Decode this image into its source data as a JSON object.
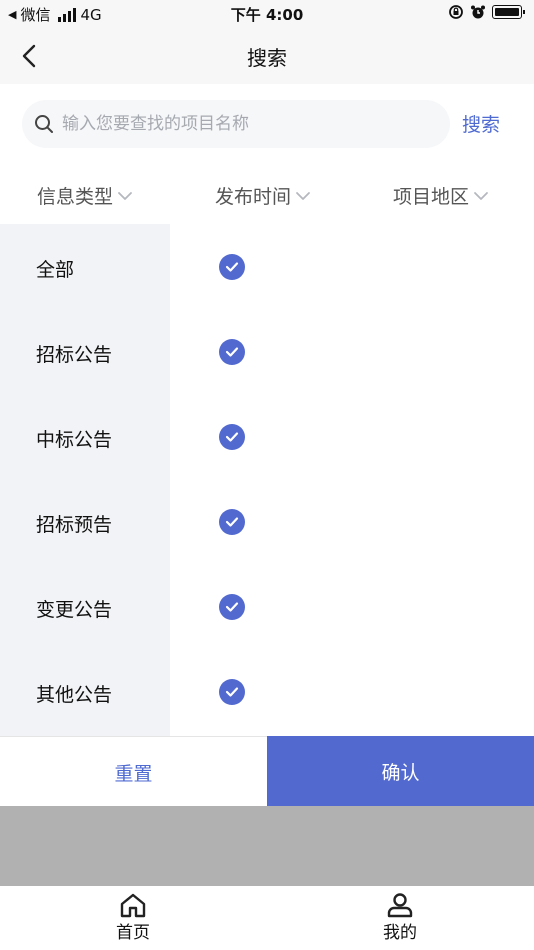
{
  "status_bar": {
    "carrier": "微信",
    "network": "4G",
    "time": "下午 4:00"
  },
  "nav": {
    "title": "搜索",
    "back_icon": "chevron-left-icon"
  },
  "search": {
    "placeholder": "输入您要查找的项目名称",
    "value": "",
    "button_label": "搜索"
  },
  "filters": [
    {
      "label": "信息类型"
    },
    {
      "label": "发布时间"
    },
    {
      "label": "项目地区"
    }
  ],
  "categories": [
    {
      "label": "全部",
      "checked": true
    },
    {
      "label": "招标公告",
      "checked": true
    },
    {
      "label": "中标公告",
      "checked": true
    },
    {
      "label": "招标预告",
      "checked": true
    },
    {
      "label": "变更公告",
      "checked": true
    },
    {
      "label": "其他公告",
      "checked": true
    }
  ],
  "actions": {
    "reset_label": "重置",
    "confirm_label": "确认"
  },
  "tab_bar": [
    {
      "label": "首页",
      "icon": "home-icon"
    },
    {
      "label": "我的",
      "icon": "user-icon"
    }
  ],
  "colors": {
    "accent": "#5269cf",
    "link": "#4f6ad1",
    "sidebar_bg": "#f2f3f6",
    "overlay": "#b1b1b1"
  }
}
